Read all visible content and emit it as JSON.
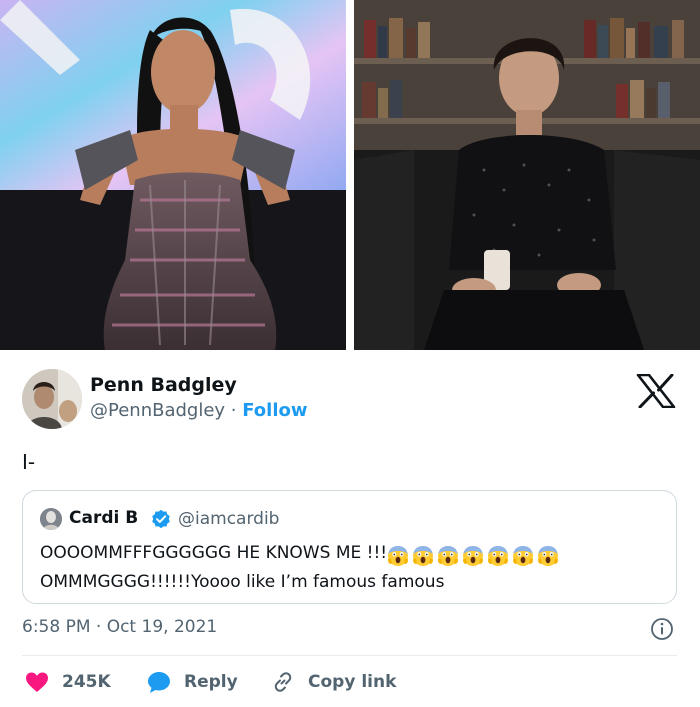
{
  "tweet": {
    "author_name": "Penn Badgley",
    "author_handle": "@PennBadgley",
    "separator": " · ",
    "follow_label": "Follow",
    "text": "I-",
    "timestamp": "6:58 PM · Oct 19, 2021"
  },
  "quote": {
    "author_name": "Cardi B",
    "author_handle": "@iamcardib",
    "text_part1": "OOOOMMFFFGGGGGG HE KNOWS ME !!!",
    "emoji_count": 7,
    "emoji_icon": "face-screaming-in-fear-icon",
    "text_part2": "OMMMGGGG!!!!!!Yoooo like I’m famous famous"
  },
  "actions": {
    "like_count": "245K",
    "reply_label": "Reply",
    "copy_label": "Copy link"
  },
  "colors": {
    "accent": "#1d9bf0",
    "like": "#f91880",
    "text": "#0f1419",
    "muted": "#536471",
    "border": "#cfd9de"
  }
}
